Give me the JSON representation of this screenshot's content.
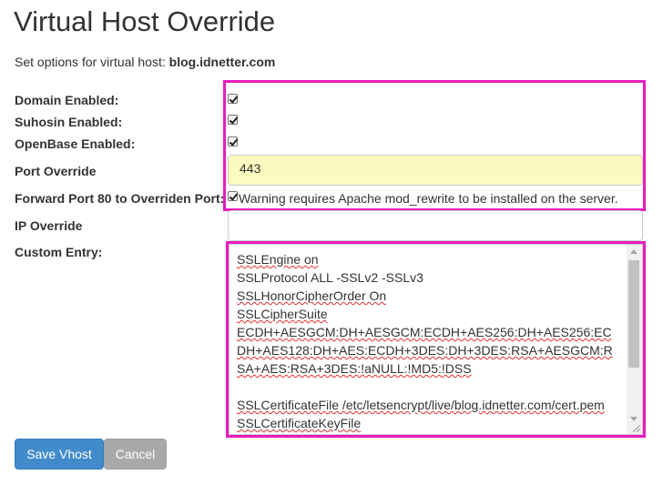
{
  "page": {
    "title": "Virtual Host Override",
    "subtitle_prefix": "Set options for virtual host:",
    "host": "blog.idnetter.com"
  },
  "form": {
    "domain_enabled": {
      "label": "Domain Enabled:",
      "checked": true
    },
    "suhosin_enabled": {
      "label": "Suhosin Enabled:",
      "checked": true
    },
    "openbase_enabled": {
      "label": "OpenBase Enabled:",
      "checked": true
    },
    "port_override": {
      "label": "Port Override",
      "value": "443"
    },
    "forward_port": {
      "label": "Forward Port 80 to Overriden Port:",
      "checked": true,
      "note": "Warning requires Apache mod_rewrite to be installed on the server."
    },
    "ip_override": {
      "label": "IP Override",
      "value": ""
    },
    "custom_entry": {
      "label": "Custom Entry:",
      "lines": [
        "SSLEngine on",
        "SSLProtocol ALL -SSLv2 -SSLv3",
        "SSLHonorCipherOrder On",
        "SSLCipherSuite",
        "ECDH+AESGCM:DH+AESGCM:ECDH+AES256:DH+AES256:ECDH+AES128:DH+AES:ECDH+3DES:DH+3DES:RSA+AESGCM:RSA+AES:RSA+3DES:!aNULL:!MD5:!DSS",
        "",
        "SSLCertificateFile /etc/letsencrypt/live/blog.idnetter.com/cert.pem",
        "SSLCertificateKeyFile"
      ]
    }
  },
  "buttons": {
    "save": "Save Vhost",
    "cancel": "Cancel"
  },
  "colors": {
    "highlight": "#e61cbe",
    "primary": "#428bca",
    "port_bg": "#fbfbbf"
  }
}
